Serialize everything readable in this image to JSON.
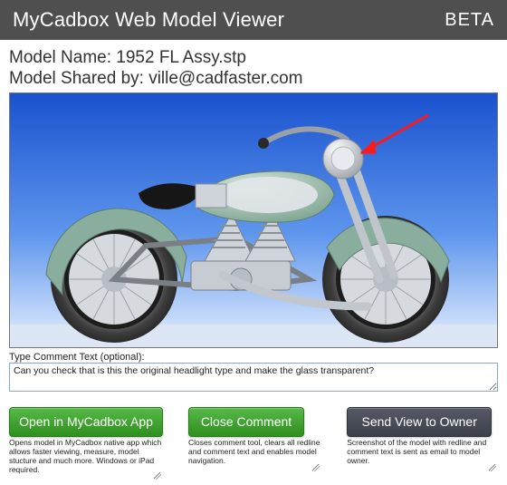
{
  "header": {
    "title": "MyCadbox Web Model Viewer",
    "badge": "BETA"
  },
  "meta": {
    "name_label": "Model Name:",
    "name_value": "1952 FL Assy.stp",
    "shared_label": "Model Shared by:",
    "shared_value": "ville@cadfaster.com"
  },
  "annotation": {
    "type": "arrow",
    "color": "#ff1a1a",
    "target": "headlight"
  },
  "comment": {
    "label": "Type Comment Text (optional):",
    "value": "Can you check that is this the original headlight type and make the glass transparent?"
  },
  "actions": {
    "open": {
      "label": "Open in MyCadbox App",
      "helper": "Opens model in MyCadbox native app which allows faster viewing, measure, model stucture and much more. Windows or iPad required."
    },
    "close": {
      "label": "Close Comment",
      "helper": "Closes comment tool, clears all redline and comment text and enables model navigation."
    },
    "send": {
      "label": "Send View to Owner",
      "helper": "Screenshot of the model with redline and comment text is sent as email to model owner."
    }
  }
}
